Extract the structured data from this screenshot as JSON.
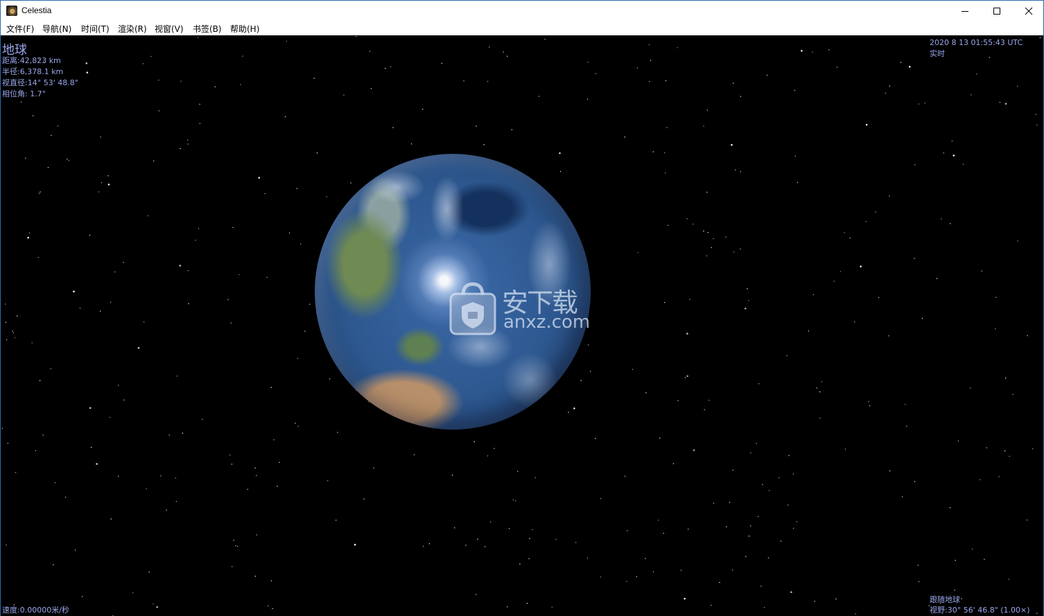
{
  "window": {
    "title": "Celestia"
  },
  "menu": [
    {
      "label": "文件(F)"
    },
    {
      "label": "导航(N)"
    },
    {
      "label": "时间(T)"
    },
    {
      "label": "渲染(R)"
    },
    {
      "label": "视窗(V)"
    },
    {
      "label": "书签(B)"
    },
    {
      "label": "帮助(H)"
    }
  ],
  "hud": {
    "object_name": "地球",
    "distance": "距离:42,823 km",
    "radius": "半径:6,378.1 km",
    "apparent_diameter": "视直径:14° 53' 48.8\"",
    "phase_angle": "相位角: 1.7°",
    "datetime": "2020 8 13 01:55:43 UTC",
    "time_mode": "实时",
    "speed": "速度:0.00000米/秒",
    "follow": "跟随地球",
    "fov": "视野:30° 56' 46.8\" (1.00×)"
  },
  "watermark": {
    "text_cn": "安下载",
    "text_en": "anxz.com"
  },
  "colors": {
    "hud_text": "#9aa6ea",
    "space": "#000000",
    "title_bg": "#ffffff",
    "window_border": "#2b6cb0"
  }
}
